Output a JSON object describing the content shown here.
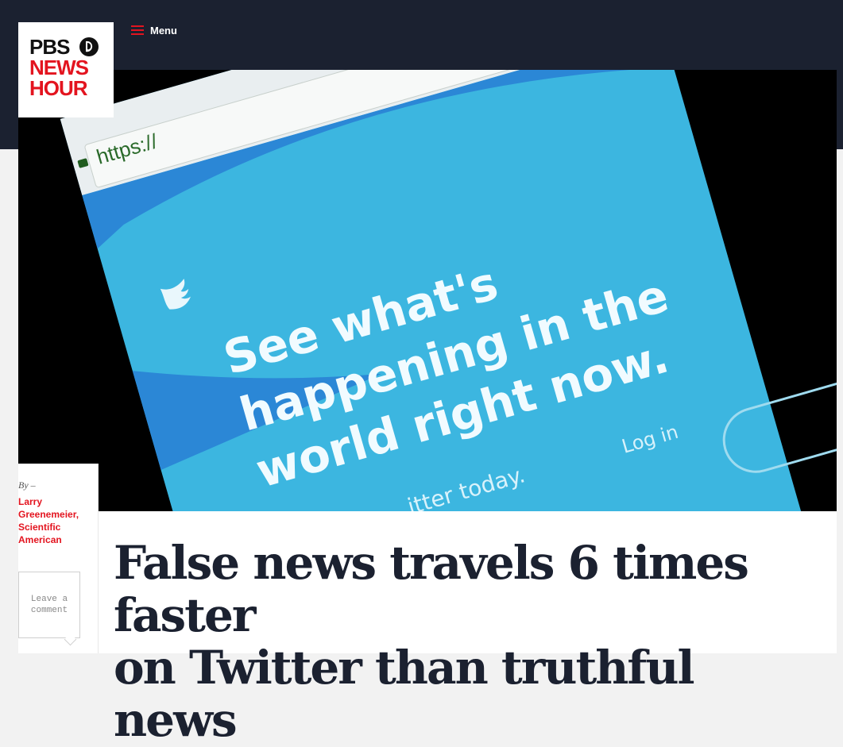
{
  "header": {
    "logo": {
      "line1": "PBS",
      "line2": "NEWS",
      "line3": "HOUR"
    },
    "menu_label": "Menu",
    "colors": {
      "bar": "#1b2130",
      "accent": "#e3141f"
    }
  },
  "hero_image": {
    "url_text": "https://",
    "tagline": [
      "See what's",
      "happening in the",
      "world right now."
    ],
    "signup_text": "itter today.",
    "login_label": "Log in"
  },
  "article": {
    "by_label": "By –",
    "author": "Larry Greenemeier, Scientific American",
    "comment_label": "Leave a comment",
    "headline_line1": "False news travels 6 times faster",
    "headline_line2": "on Twitter than truthful news"
  }
}
